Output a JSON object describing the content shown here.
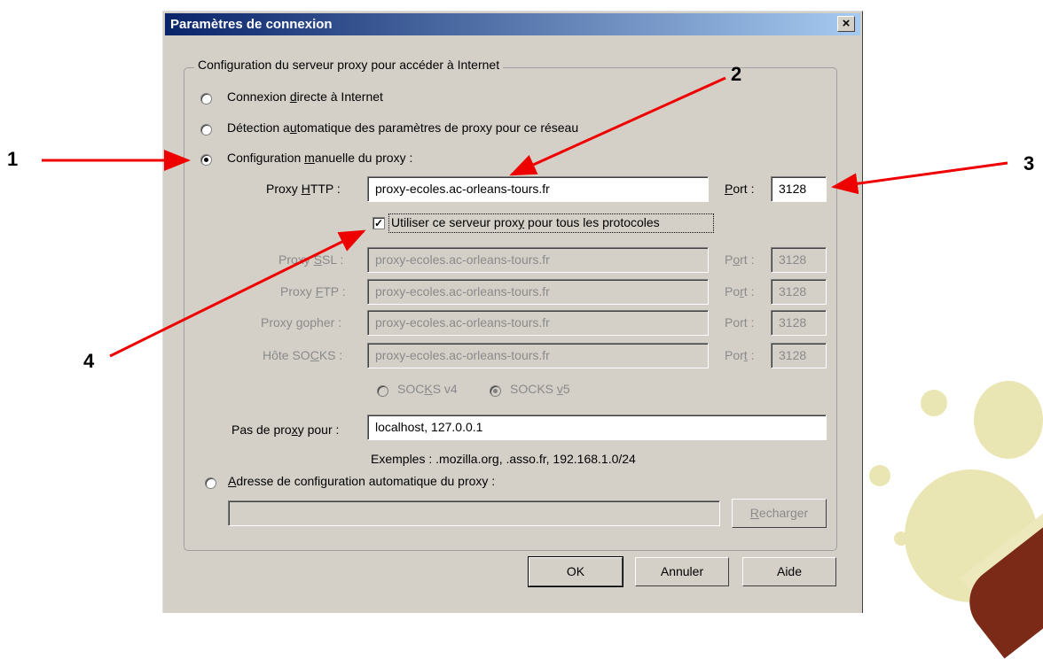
{
  "dialog": {
    "title": "Paramètres de connexion",
    "close_glyph": "×"
  },
  "group": {
    "legend": "Configuration du serveur proxy pour accéder à Internet"
  },
  "options": {
    "direct": {
      "pre": "Connexion ",
      "acc": "d",
      "post": "irecte à Internet",
      "selected": false
    },
    "auto_detect": {
      "pre": "Détection a",
      "acc": "u",
      "post": "tomatique des paramètres de proxy pour ce réseau",
      "selected": false
    },
    "manual": {
      "pre": "Configuration ",
      "acc": "m",
      "post": "anuelle du proxy :",
      "selected": true
    },
    "auto_config": {
      "pre": "",
      "acc": "A",
      "post": "dresse de configuration automatique du proxy :",
      "selected": false
    }
  },
  "http": {
    "label_pre": "Proxy ",
    "label_acc": "H",
    "label_post": "TTP :",
    "value": "proxy-ecoles.ac-orleans-tours.fr",
    "port_acc": "P",
    "port_post": "ort :",
    "port": "3128"
  },
  "use_for_all": {
    "pre": "Utiliser ce serveur prox",
    "acc": "y",
    "post": " pour tous les protocoles",
    "checked": true,
    "check_glyph": "✓"
  },
  "ssl": {
    "label_pre": "Proxy ",
    "label_acc": "S",
    "label_post": "SL :",
    "value": "proxy-ecoles.ac-orleans-tours.fr",
    "port_pre": "P",
    "port_acc": "o",
    "port_post": "rt :",
    "port": "3128"
  },
  "ftp": {
    "label_pre": "Proxy ",
    "label_acc": "F",
    "label_post": "TP :",
    "value": "proxy-ecoles.ac-orleans-tours.fr",
    "port_pre": "Po",
    "port_acc": "r",
    "port_post": "t :",
    "port": "3128"
  },
  "gopher": {
    "label_pre": "Proxy ",
    "label_acc": "g",
    "label_post": "opher :",
    "value": "proxy-ecoles.ac-orleans-tours.fr",
    "port_label": "Port :",
    "port": "3128"
  },
  "socks": {
    "label_pre": "Hôte SO",
    "label_acc": "C",
    "label_post": "KS :",
    "value": "proxy-ecoles.ac-orleans-tours.fr",
    "port_pre": "Por",
    "port_acc": "t",
    "port_post": " :",
    "port": "3128",
    "v4_pre": "SOC",
    "v4_acc": "K",
    "v4_post": "S v4",
    "v5_pre": "SOCKS ",
    "v5_acc": "v",
    "v5_post": "5",
    "selected": "v5"
  },
  "no_proxy": {
    "label_pre": "Pas de pro",
    "label_acc": "x",
    "label_post": "y pour :",
    "value": "localhost, 127.0.0.1",
    "examples": "Exemples : .mozilla.org, .asso.fr, 192.168.1.0/24"
  },
  "autoconfig": {
    "value": "",
    "reload_pre": "",
    "reload_acc": "R",
    "reload_post": "echarger"
  },
  "buttons": {
    "ok": "OK",
    "cancel": "Annuler",
    "help": "Aide"
  },
  "annotations": {
    "a1": "1",
    "a2": "2",
    "a3": "3",
    "a4": "4"
  },
  "colors": {
    "titlebar_start": "#0a246a",
    "titlebar_end": "#a6caf0",
    "dialog_bg": "#d4d0c8",
    "arrow": "#ee0000",
    "decoration": "#e9e6b4"
  }
}
